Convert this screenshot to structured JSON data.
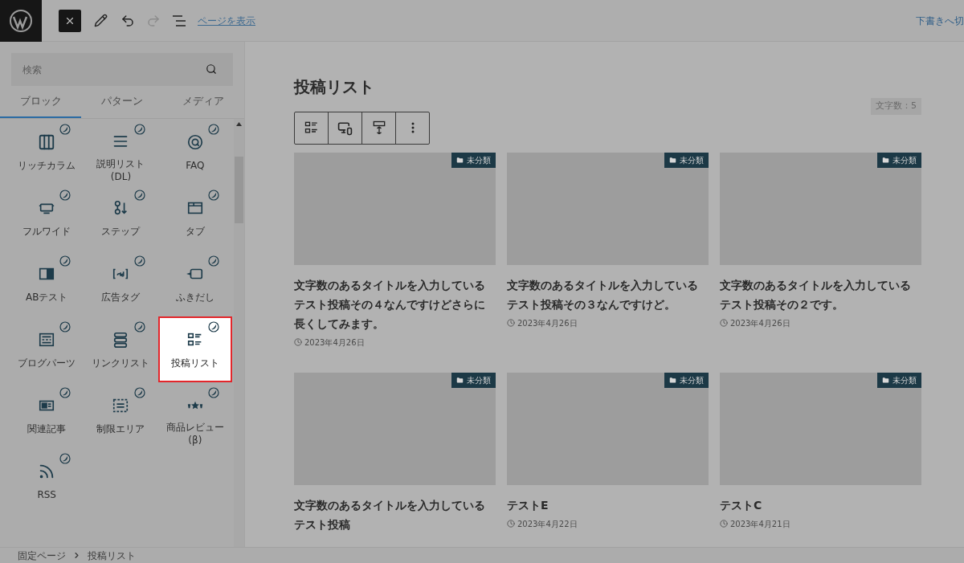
{
  "top_bar": {
    "view_page_link": "ページを表示",
    "draft_link": "下書きへ切"
  },
  "inserter": {
    "search": {
      "placeholder": "検索"
    },
    "tabs": [
      {
        "label": "ブロック",
        "selected": true
      },
      {
        "label": "パターン",
        "selected": false
      },
      {
        "label": "メディア",
        "selected": false
      }
    ],
    "blocks": [
      {
        "label": "リッチカラム",
        "selected": false
      },
      {
        "label": "説明リスト\n(DL)",
        "selected": false
      },
      {
        "label": "FAQ",
        "selected": false
      },
      {
        "label": "フルワイド",
        "selected": false
      },
      {
        "label": "ステップ",
        "selected": false
      },
      {
        "label": "タブ",
        "selected": false
      },
      {
        "label": "ABテスト",
        "selected": false
      },
      {
        "label": "広告タグ",
        "selected": false
      },
      {
        "label": "ふきだし",
        "selected": false
      },
      {
        "label": "ブログパーツ",
        "selected": false
      },
      {
        "label": "リンクリスト",
        "selected": false
      },
      {
        "label": "投稿リスト",
        "selected": true
      },
      {
        "label": "関連記事",
        "selected": false
      },
      {
        "label": "制限エリア",
        "selected": false
      },
      {
        "label": "商品レビュー\n(β)",
        "selected": false
      },
      {
        "label": "RSS",
        "selected": false
      }
    ]
  },
  "editor": {
    "title": "投稿リスト",
    "word_count": "文字数：5",
    "posts": [
      {
        "category": "未分類",
        "title": "文字数のあるタイトルを入力しているテスト投稿その４なんですけどさらに長くしてみます。",
        "date": "2023年4月26日"
      },
      {
        "category": "未分類",
        "title": "文字数のあるタイトルを入力しているテスト投稿その３なんですけど。",
        "date": "2023年4月26日"
      },
      {
        "category": "未分類",
        "title": "文字数のあるタイトルを入力しているテスト投稿その２です。",
        "date": "2023年4月26日"
      },
      {
        "category": "未分類",
        "title": "文字数のあるタイトルを入力しているテスト投稿"
      },
      {
        "category": "未分類",
        "title": "テストE",
        "date": "2023年4月22日"
      },
      {
        "category": "未分類",
        "title": "テストC",
        "date": "2023年4月21日"
      }
    ]
  },
  "breadcrumb": [
    "固定ページ",
    "投稿リスト"
  ]
}
